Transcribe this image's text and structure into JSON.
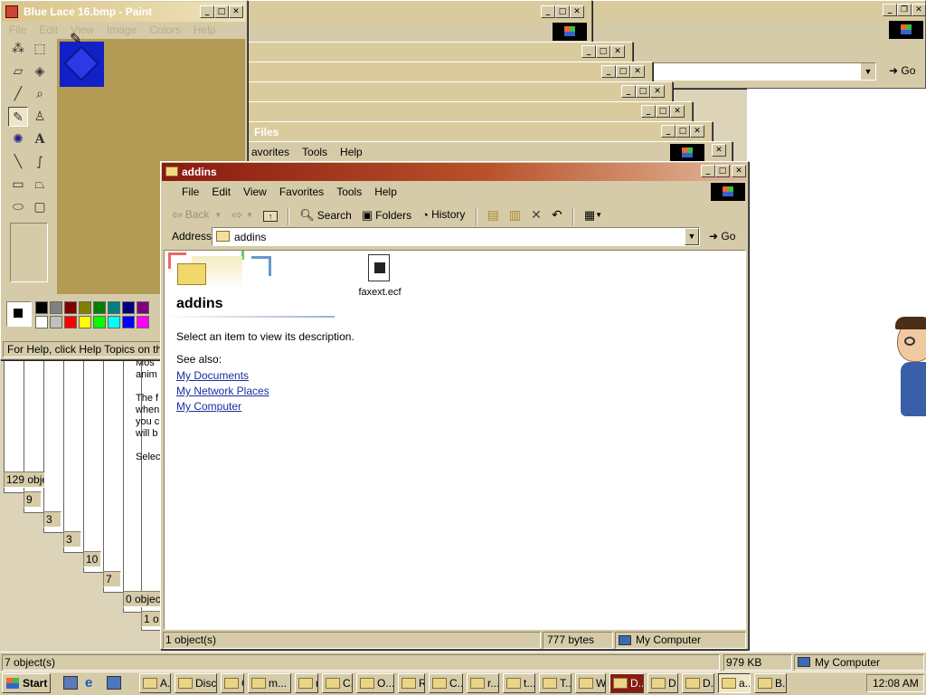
{
  "desktop_bg": "#dcd3b8",
  "paint": {
    "title": "Blue Lace 16.bmp - Paint",
    "menu": [
      "File",
      "Edit",
      "View",
      "Image",
      "Colors",
      "Help"
    ],
    "status": "For Help, click Help Topics on the H",
    "palette": [
      "#000000",
      "#808080",
      "#800000",
      "#808000",
      "#008000",
      "#008080",
      "#000080",
      "#800080",
      "#ffffff",
      "#c0c0c0",
      "#ff0000",
      "#ffff00",
      "#00ff00",
      "#00ffff",
      "#0000ff",
      "#ff00ff"
    ],
    "tools": [
      "free-select-icon",
      "rect-select-icon",
      "eraser-icon",
      "fill-icon",
      "eyedropper-icon",
      "magnifier-icon",
      "pencil-icon",
      "brush-icon",
      "airbrush-icon",
      "text-icon",
      "line-icon",
      "curve-icon",
      "rectangle-icon",
      "polygon-icon",
      "ellipse-icon",
      "rounded-rect-icon"
    ]
  },
  "back_windows": {
    "address_go": "Go",
    "files_title": "Files",
    "partial_menu": [
      "avorites",
      "Tools",
      "Help"
    ],
    "counts": [
      "129 obje",
      "9 o",
      "3 o",
      "3 o",
      "10",
      "7 o",
      "0 object",
      "1 o"
    ],
    "text_lines": [
      "Mos",
      "anim",
      "The f",
      "when",
      "you c",
      "will b",
      "Selec"
    ],
    "status_left": "7 object(s)",
    "status_size": "979 KB",
    "status_zone": "My Computer"
  },
  "explorer": {
    "title": "addins",
    "menu": [
      "File",
      "Edit",
      "View",
      "Favorites",
      "Tools",
      "Help"
    ],
    "toolbar": {
      "back": "Back",
      "search": "Search",
      "folders": "Folders",
      "history": "History"
    },
    "address_label": "Address",
    "address_value": "addins",
    "go": "Go",
    "folder_heading": "addins",
    "description": "Select an item to view its description.",
    "see_also": "See also:",
    "links": [
      "My Documents",
      "My Network Places",
      "My Computer"
    ],
    "file_name": "faxext.ecf",
    "status_count": "1 object(s)",
    "status_size": "777 bytes",
    "status_zone": "My Computer"
  },
  "taskbar": {
    "start": "Start",
    "items": [
      "A...",
      "Disc...",
      "C...",
      "m...",
      "m...",
      "C...",
      "O...",
      "R...",
      "C...",
      "r...",
      "t...",
      "T...",
      "W...",
      "D...",
      "D...",
      "D...",
      "a...",
      "B..."
    ],
    "clock": "12:08 AM"
  }
}
